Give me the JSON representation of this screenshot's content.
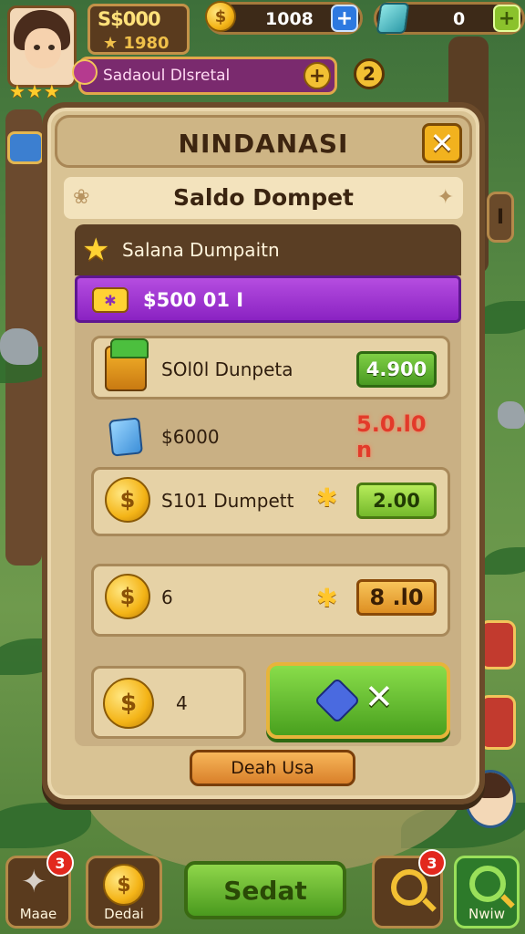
{
  "hud": {
    "money_top": "S$000",
    "money_bottom": "1980",
    "money_bottom_icon": "★",
    "coins": "1008",
    "gems": "0",
    "plus": "+",
    "player_name": "Sadaoul Dlsretal",
    "level": "2",
    "side_right_label": "I"
  },
  "panel": {
    "title": "NINDANASI",
    "close_symbol": "✕",
    "subtitle": "Saldo Dompet",
    "header_row_label": "Salana Dumpaitn",
    "purple_row_label": "$500 01   I",
    "items": [
      {
        "label": "SOl0l Dunpeta",
        "value": "4.900",
        "style": "green",
        "icon": "gift-box-icon"
      },
      {
        "label": "$6000",
        "value": "5.0.l0 n",
        "style": "red",
        "icon": "card-icon"
      },
      {
        "label": "S101 Dumpett",
        "value": "2.00",
        "style": "lime",
        "icon": "coin-icon"
      },
      {
        "label": "6",
        "value": "8 .l0",
        "style": "orange",
        "icon": "coin-icon"
      }
    ],
    "small_card_label": "4",
    "confirm_symbol": "✕",
    "bottom_button": "Deah Usa"
  },
  "nav": {
    "left_label": "Maae",
    "left_badge": "3",
    "coin_label": "Dedai",
    "center_label": "Sedat",
    "right_badge": "3",
    "far_right_label": "Nwiw"
  },
  "colors": {
    "panel_bg": "#d9c394",
    "panel_border": "#6b4a2a",
    "accent_purple": "#8a22c2",
    "accent_green": "#4a9a22",
    "accent_gold": "#f2c033"
  }
}
